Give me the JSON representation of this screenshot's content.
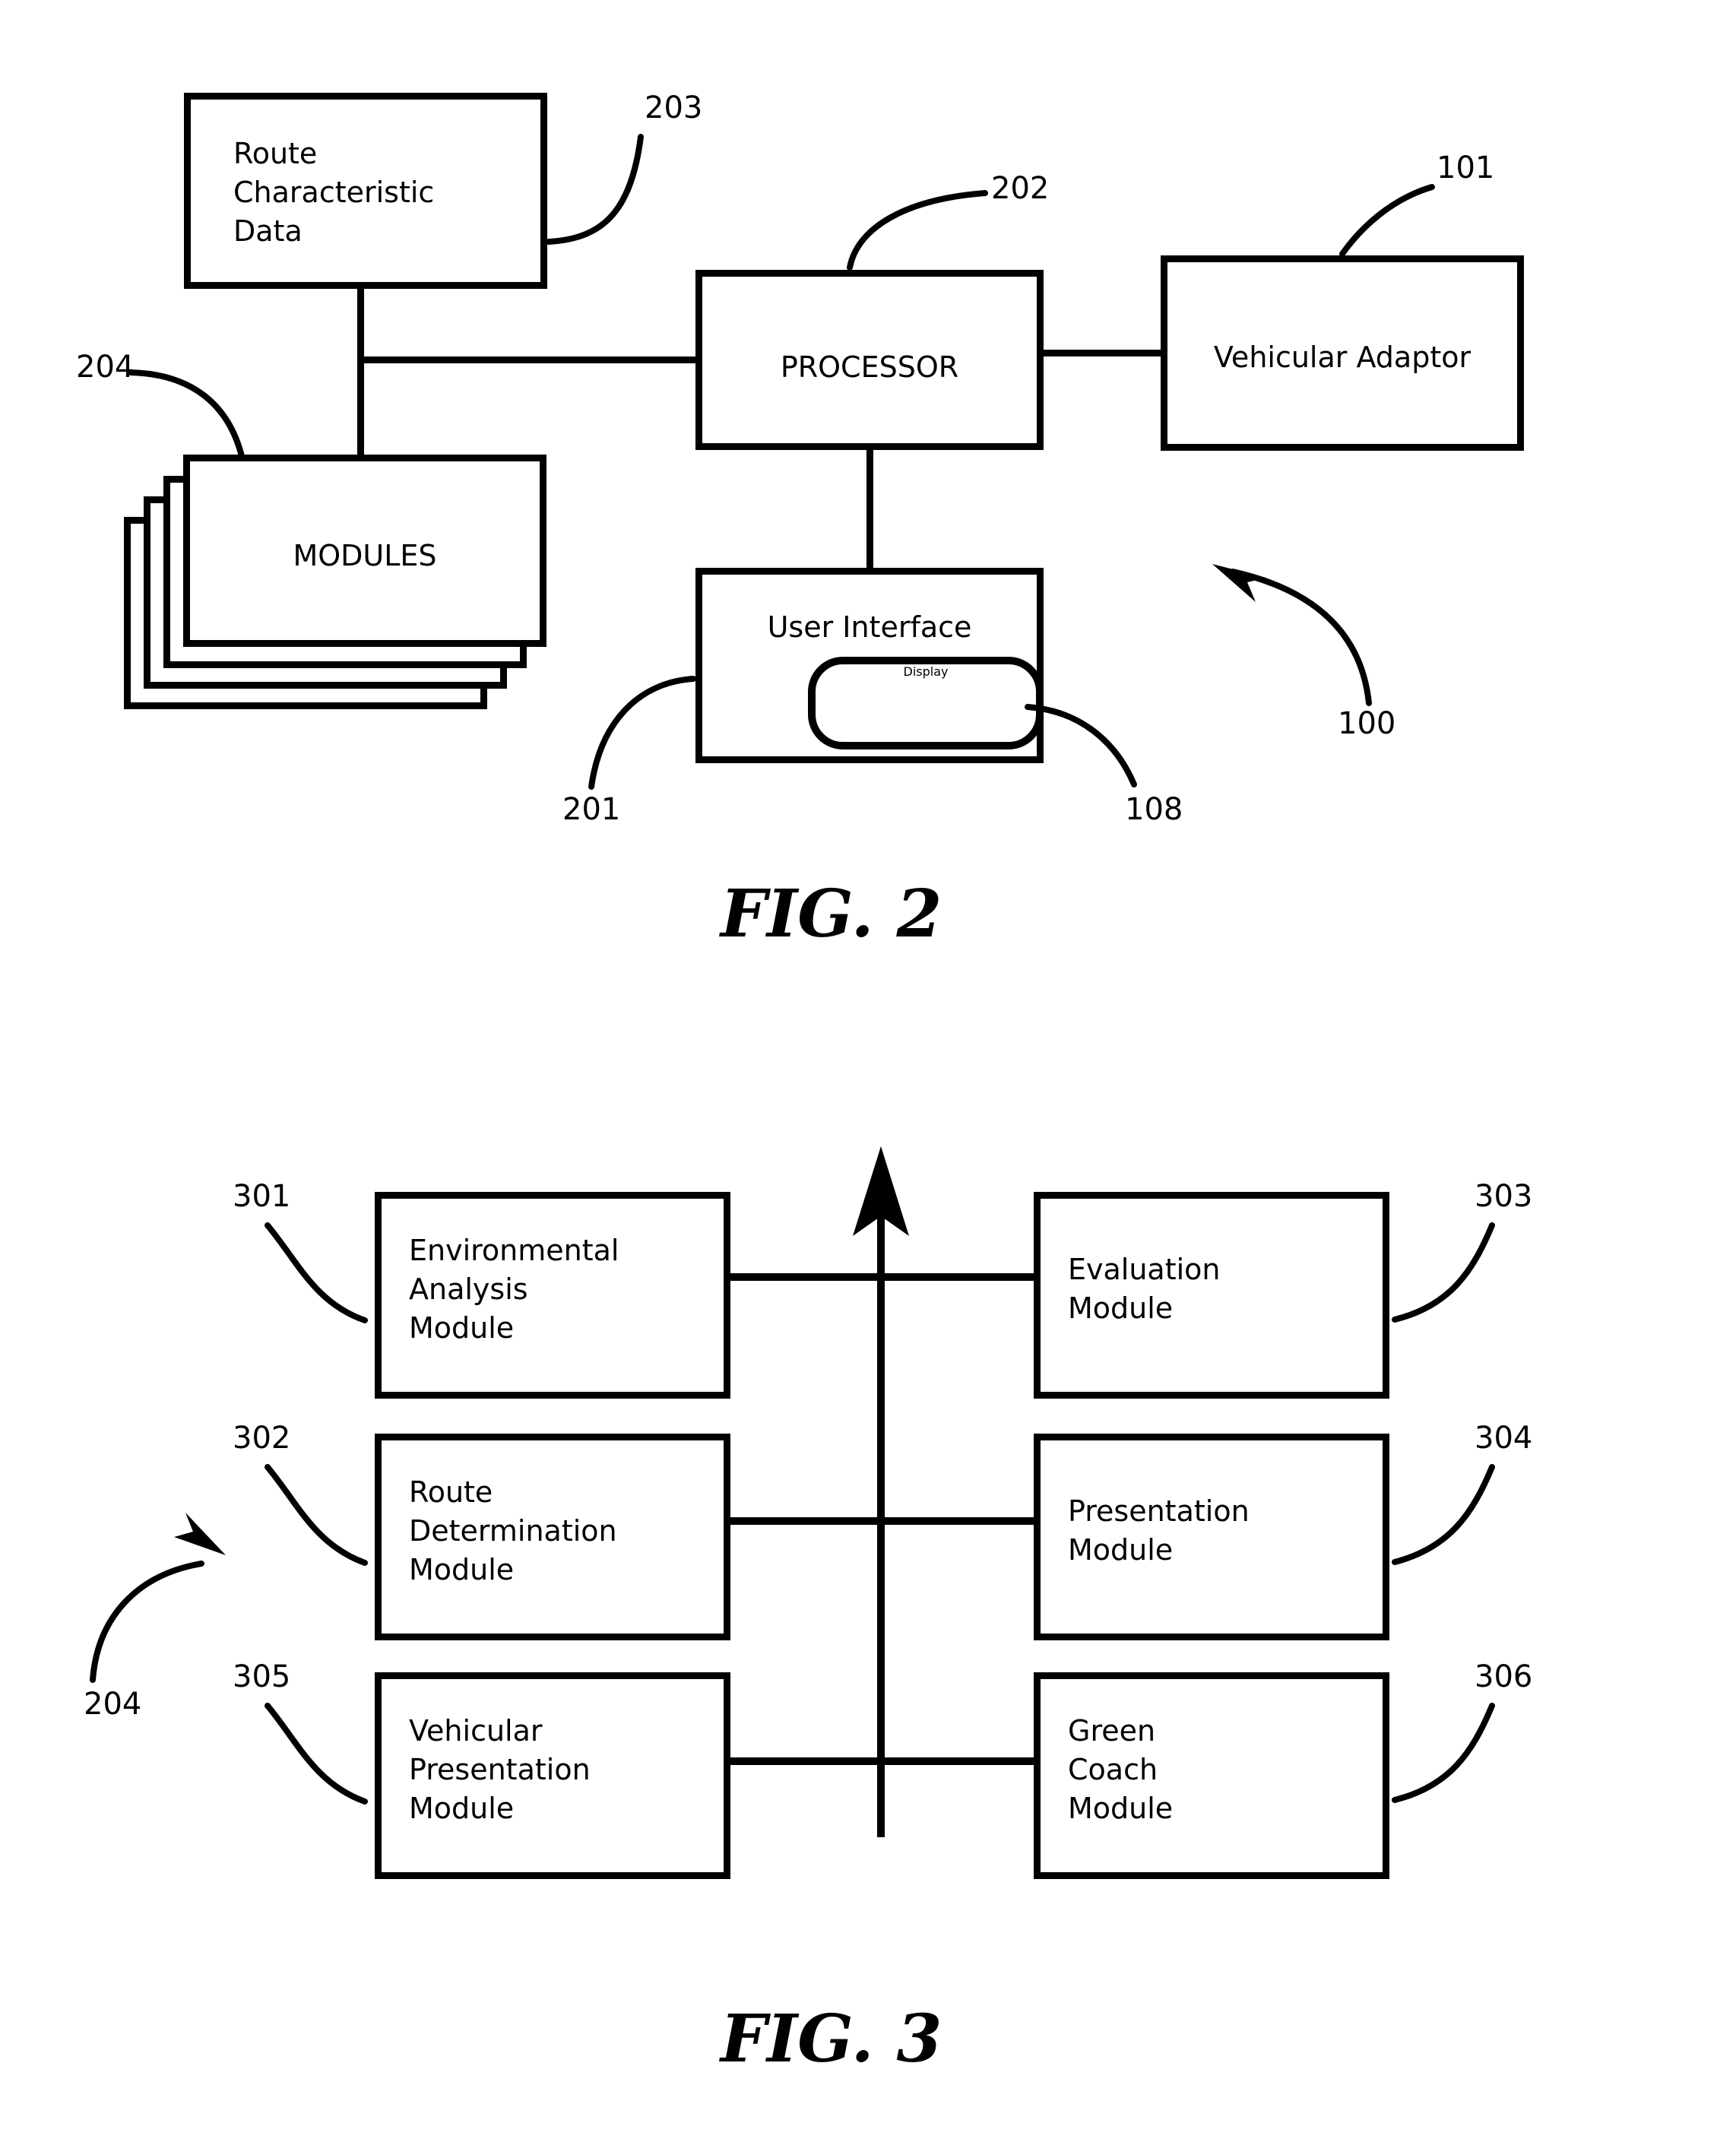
{
  "document": {
    "type": "patent-drawing-sheet",
    "figures": [
      {
        "caption": "FIG. 2",
        "blocks": [
          {
            "ref": "203",
            "label": "Route\nCharacteristic\nData"
          },
          {
            "ref": "202",
            "label": "PROCESSOR"
          },
          {
            "ref": "101",
            "label": "Vehicular Adaptor"
          },
          {
            "ref": "204",
            "label": "MODULES"
          },
          {
            "ref": "201",
            "label": "User Interface"
          },
          {
            "ref": "108",
            "label": "Display"
          }
        ],
        "system_ref": "100"
      },
      {
        "caption": "FIG. 3",
        "blocks": [
          {
            "ref": "301",
            "label": "Environmental\nAnalysis\nModule"
          },
          {
            "ref": "303",
            "label": "Evaluation\nModule"
          },
          {
            "ref": "302",
            "label": "Route\nDetermination\nModule"
          },
          {
            "ref": "304",
            "label": "Presentation\nModule"
          },
          {
            "ref": "305",
            "label": "Vehicular\nPresentation\nModule"
          },
          {
            "ref": "306",
            "label": "Green\nCoach\nModule"
          }
        ],
        "system_ref": "204"
      }
    ]
  },
  "fig2": {
    "caption": "FIG. 2",
    "route_data": {
      "label": "Route\nCharacteristic\nData",
      "ref": "203"
    },
    "processor": {
      "label": "PROCESSOR",
      "ref": "202"
    },
    "vehicular_adaptor": {
      "label": "Vehicular Adaptor",
      "ref": "101"
    },
    "modules": {
      "label": "MODULES",
      "ref": "204"
    },
    "user_interface": {
      "label": "User Interface",
      "ref": "201"
    },
    "display": {
      "label": "Display",
      "ref": "108"
    },
    "system": {
      "ref": "100"
    }
  },
  "fig3": {
    "caption": "FIG. 3",
    "system": {
      "ref": "204"
    },
    "environmental_analysis": {
      "label": "Environmental\nAnalysis\nModule",
      "ref": "301"
    },
    "evaluation": {
      "label": "Evaluation\nModule",
      "ref": "303"
    },
    "route_determination": {
      "label": "Route\nDetermination\nModule",
      "ref": "302"
    },
    "presentation": {
      "label": "Presentation\nModule",
      "ref": "304"
    },
    "vehicular_presentation": {
      "label": "Vehicular\nPresentation\nModule",
      "ref": "305"
    },
    "green_coach": {
      "label": "Green\nCoach\nModule",
      "ref": "306"
    }
  },
  "colors": {
    "ink": "#000000",
    "paper": "#ffffff"
  }
}
